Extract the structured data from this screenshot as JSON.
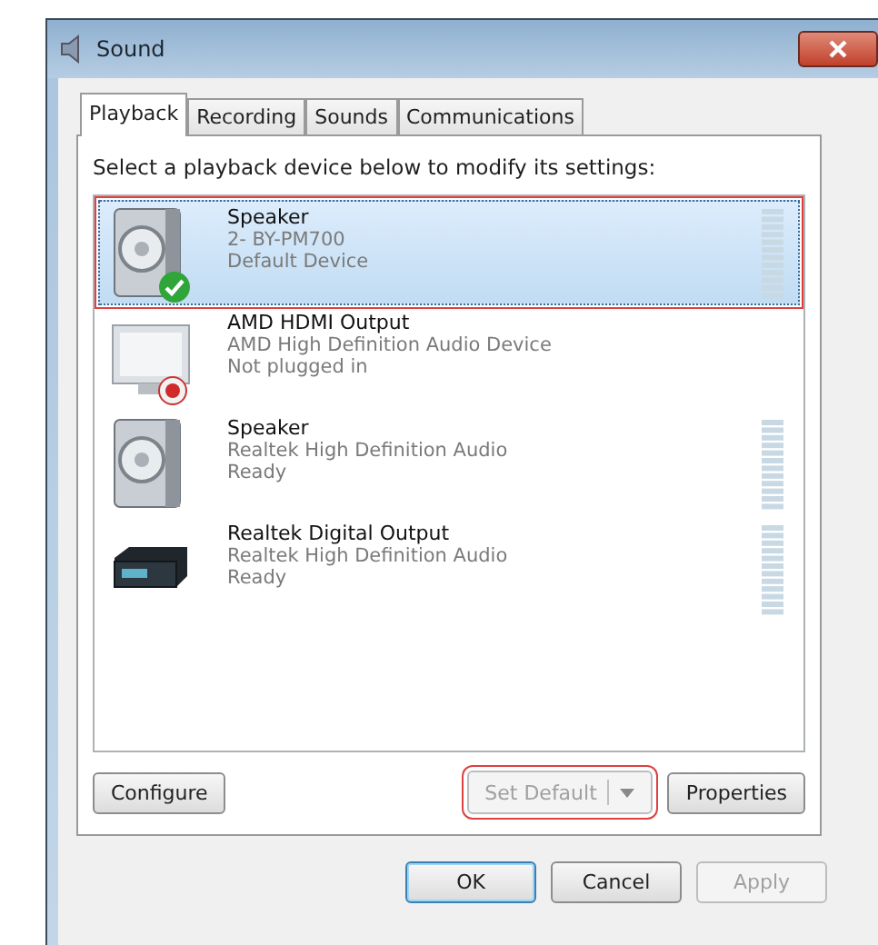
{
  "window": {
    "title": "Sound"
  },
  "tabs": [
    {
      "label": "Playback",
      "selected": true
    },
    {
      "label": "Recording",
      "selected": false
    },
    {
      "label": "Sounds",
      "selected": false
    },
    {
      "label": "Communications",
      "selected": false
    }
  ],
  "instruction": "Select a playback device below to modify its settings:",
  "devices": [
    {
      "kind": "speaker",
      "name": "Speaker",
      "driver": "2- BY-PM700",
      "status": "Default Device",
      "selected": true,
      "highlighted": true,
      "is_default": true,
      "unplugged": false,
      "meter": true
    },
    {
      "kind": "monitor",
      "name": "AMD HDMI Output",
      "driver": "AMD High Definition Audio Device",
      "status": "Not plugged in",
      "selected": false,
      "highlighted": false,
      "is_default": false,
      "unplugged": true,
      "meter": false
    },
    {
      "kind": "speaker",
      "name": "Speaker",
      "driver": "Realtek High Definition Audio",
      "status": "Ready",
      "selected": false,
      "highlighted": false,
      "is_default": false,
      "unplugged": false,
      "meter": true
    },
    {
      "kind": "receiver",
      "name": "Realtek Digital Output",
      "driver": "Realtek High Definition Audio",
      "status": "Ready",
      "selected": false,
      "highlighted": false,
      "is_default": false,
      "unplugged": false,
      "meter": true
    }
  ],
  "configure_button": {
    "label": "Configure",
    "disabled": false
  },
  "set_default_button": {
    "label": "Set Default",
    "disabled": true,
    "highlighted": true
  },
  "properties_button": {
    "label": "Properties",
    "disabled": false
  },
  "dialog_buttons": [
    {
      "label": "OK",
      "disabled": false,
      "default": true
    },
    {
      "label": "Cancel",
      "disabled": false,
      "default": false
    },
    {
      "label": "Apply",
      "disabled": true,
      "default": false
    }
  ]
}
